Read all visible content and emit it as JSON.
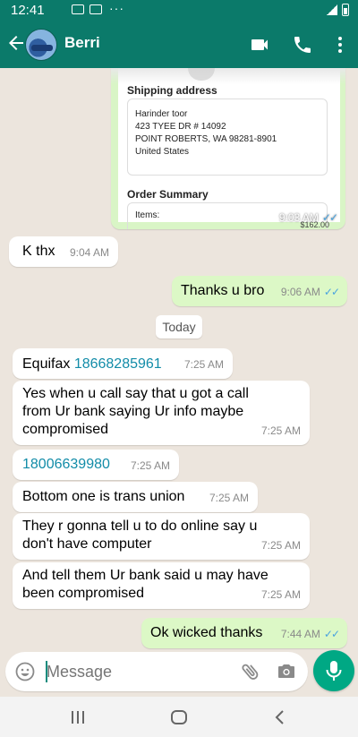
{
  "status_bar": {
    "time": "12:41",
    "more_dots": "···"
  },
  "header": {
    "contact_name": "Berri"
  },
  "receipt_preview": {
    "shipping_label": "Shipping address",
    "address_lines": [
      "Harinder toor",
      "423 TYEE DR # 14092",
      "POINT ROBERTS, WA 98281-8901",
      "United States"
    ],
    "order_label": "Order Summary",
    "items_label": "Items:",
    "price": "$162.00",
    "time": "9:03 AM"
  },
  "messages": [
    {
      "id": "m1",
      "dir": "in",
      "text": "K thx",
      "time": "9:04 AM"
    },
    {
      "id": "m2",
      "dir": "out",
      "text": "Thanks u bro",
      "time": "9:06 AM"
    },
    {
      "id": "m3",
      "dir": "in",
      "prefix": "Equifax ",
      "link": "18668285961",
      "time": "7:25 AM"
    },
    {
      "id": "m4",
      "dir": "in",
      "lines": [
        "Yes when u call say that u got a call",
        "from Ur bank saying Ur info maybe",
        "compromised"
      ],
      "time": "7:25 AM"
    },
    {
      "id": "m5",
      "dir": "in",
      "link": "18006639980",
      "time": "7:25 AM"
    },
    {
      "id": "m6",
      "dir": "in",
      "text": "Bottom one is trans union",
      "time": "7:25 AM"
    },
    {
      "id": "m7",
      "dir": "in",
      "lines": [
        "They r gonna tell u to do online say u",
        "don't have computer"
      ],
      "time": "7:25 AM"
    },
    {
      "id": "m8",
      "dir": "in",
      "lines": [
        "And tell them Ur bank said u may have",
        "been compromised"
      ],
      "time": "7:25 AM"
    },
    {
      "id": "m9",
      "dir": "out",
      "text": "Ok wicked thanks",
      "time": "7:44 AM"
    }
  ],
  "date_chip": "Today",
  "composer": {
    "placeholder": "Message"
  },
  "colors": {
    "header": "#0b7a6a",
    "outgoing": "#dcf8c6",
    "accent": "#00a884",
    "link": "#128ca8",
    "read_ticks": "#4aa3df"
  },
  "icons": [
    "back-arrow-icon",
    "video-call-icon",
    "phone-icon",
    "more-vert-icon",
    "emoji-icon",
    "attach-icon",
    "camera-icon",
    "mic-icon"
  ]
}
